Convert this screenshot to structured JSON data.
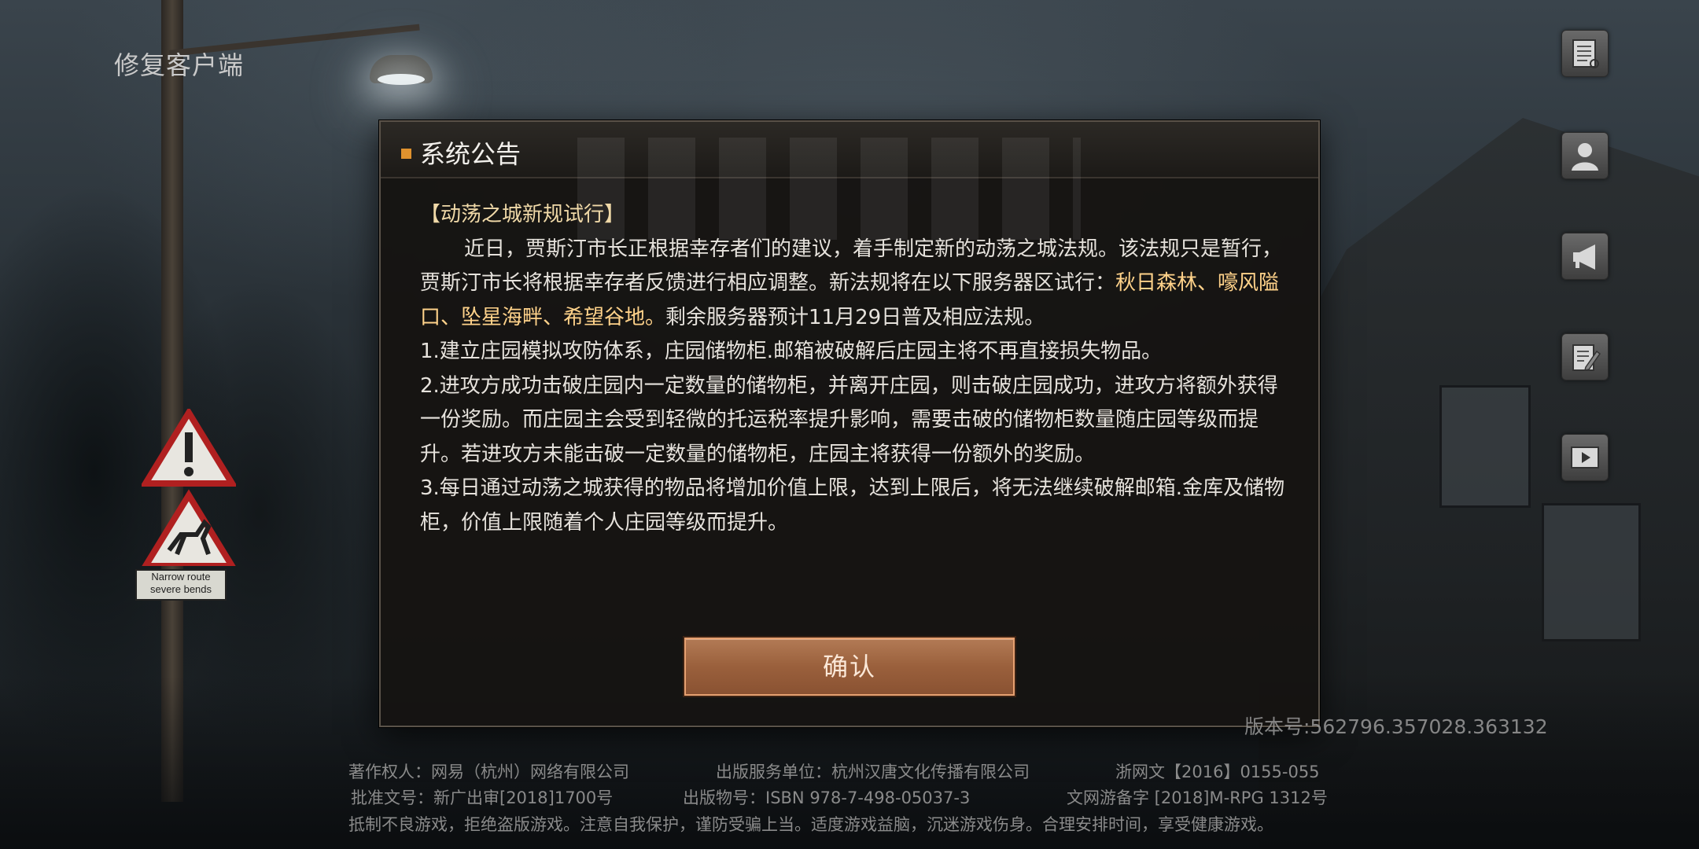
{
  "top_left": {
    "repair_label": "修复客户端"
  },
  "side_buttons": [
    {
      "icon": "notice-board-icon"
    },
    {
      "icon": "user-icon"
    },
    {
      "icon": "megaphone-icon"
    },
    {
      "icon": "edit-notes-icon"
    },
    {
      "icon": "video-play-icon"
    }
  ],
  "sign": {
    "line1": "Narrow route",
    "line2": "severe bends"
  },
  "dialog": {
    "title": "系统公告",
    "subtitle": "【动荡之城新规试行】",
    "para1_start": "近日，贾斯汀市长正根据幸存者们的建议，着手制定新的动荡之城法规。该法规只是暂行，贾斯汀市长将根据幸存者反馈进行相应调整。新法规将在以下服务器区试行：",
    "para1_highlight": "秋日森林、嚎风隘口、坠星海畔、希望谷地。",
    "para1_end": "剩余服务器预计11月29日普及相应法规。",
    "rule1": "1.建立庄园模拟攻防体系，庄园储物柜.邮箱被破解后庄园主将不再直接损失物品。",
    "rule2": "2.进攻方成功击破庄园内一定数量的储物柜，并离开庄园，则击破庄园成功，进攻方将额外获得一份奖励。而庄园主会受到轻微的托运税率提升影响，需要击破的储物柜数量随庄园等级而提升。若进攻方未能击破一定数量的储物柜，庄园主将获得一份额外的奖励。",
    "rule3": "3.每日通过动荡之城获得的物品将增加价值上限，达到上限后，将无法继续破解邮箱.金库及储物柜，价值上限随着个人庄园等级而提升。",
    "confirm_label": "确认"
  },
  "version_text": "版本号:562796.357028.363132",
  "footer": {
    "copyright": "著作权人：网易（杭州）网络有限公司",
    "publisher": "出版服务单位：杭州汉唐文化传播有限公司",
    "zhewangwen": "浙网文【2016】0155-055",
    "approval": "批准文号：新广出审[2018]1700号",
    "isbn": "出版物号：ISBN 978-7-498-05037-3",
    "record": "文网游备字 [2018]M-RPG 1312号",
    "health_notice": "抵制不良游戏，拒绝盗版游戏。注意自我保护，谨防受骗上当。适度游戏益脑，沉迷游戏伤身。合理安排时间，享受健康游戏。"
  },
  "colors": {
    "accent_orange": "#e0922e",
    "highlight_text": "#ffd28a",
    "button_fill": "#9a603c"
  }
}
